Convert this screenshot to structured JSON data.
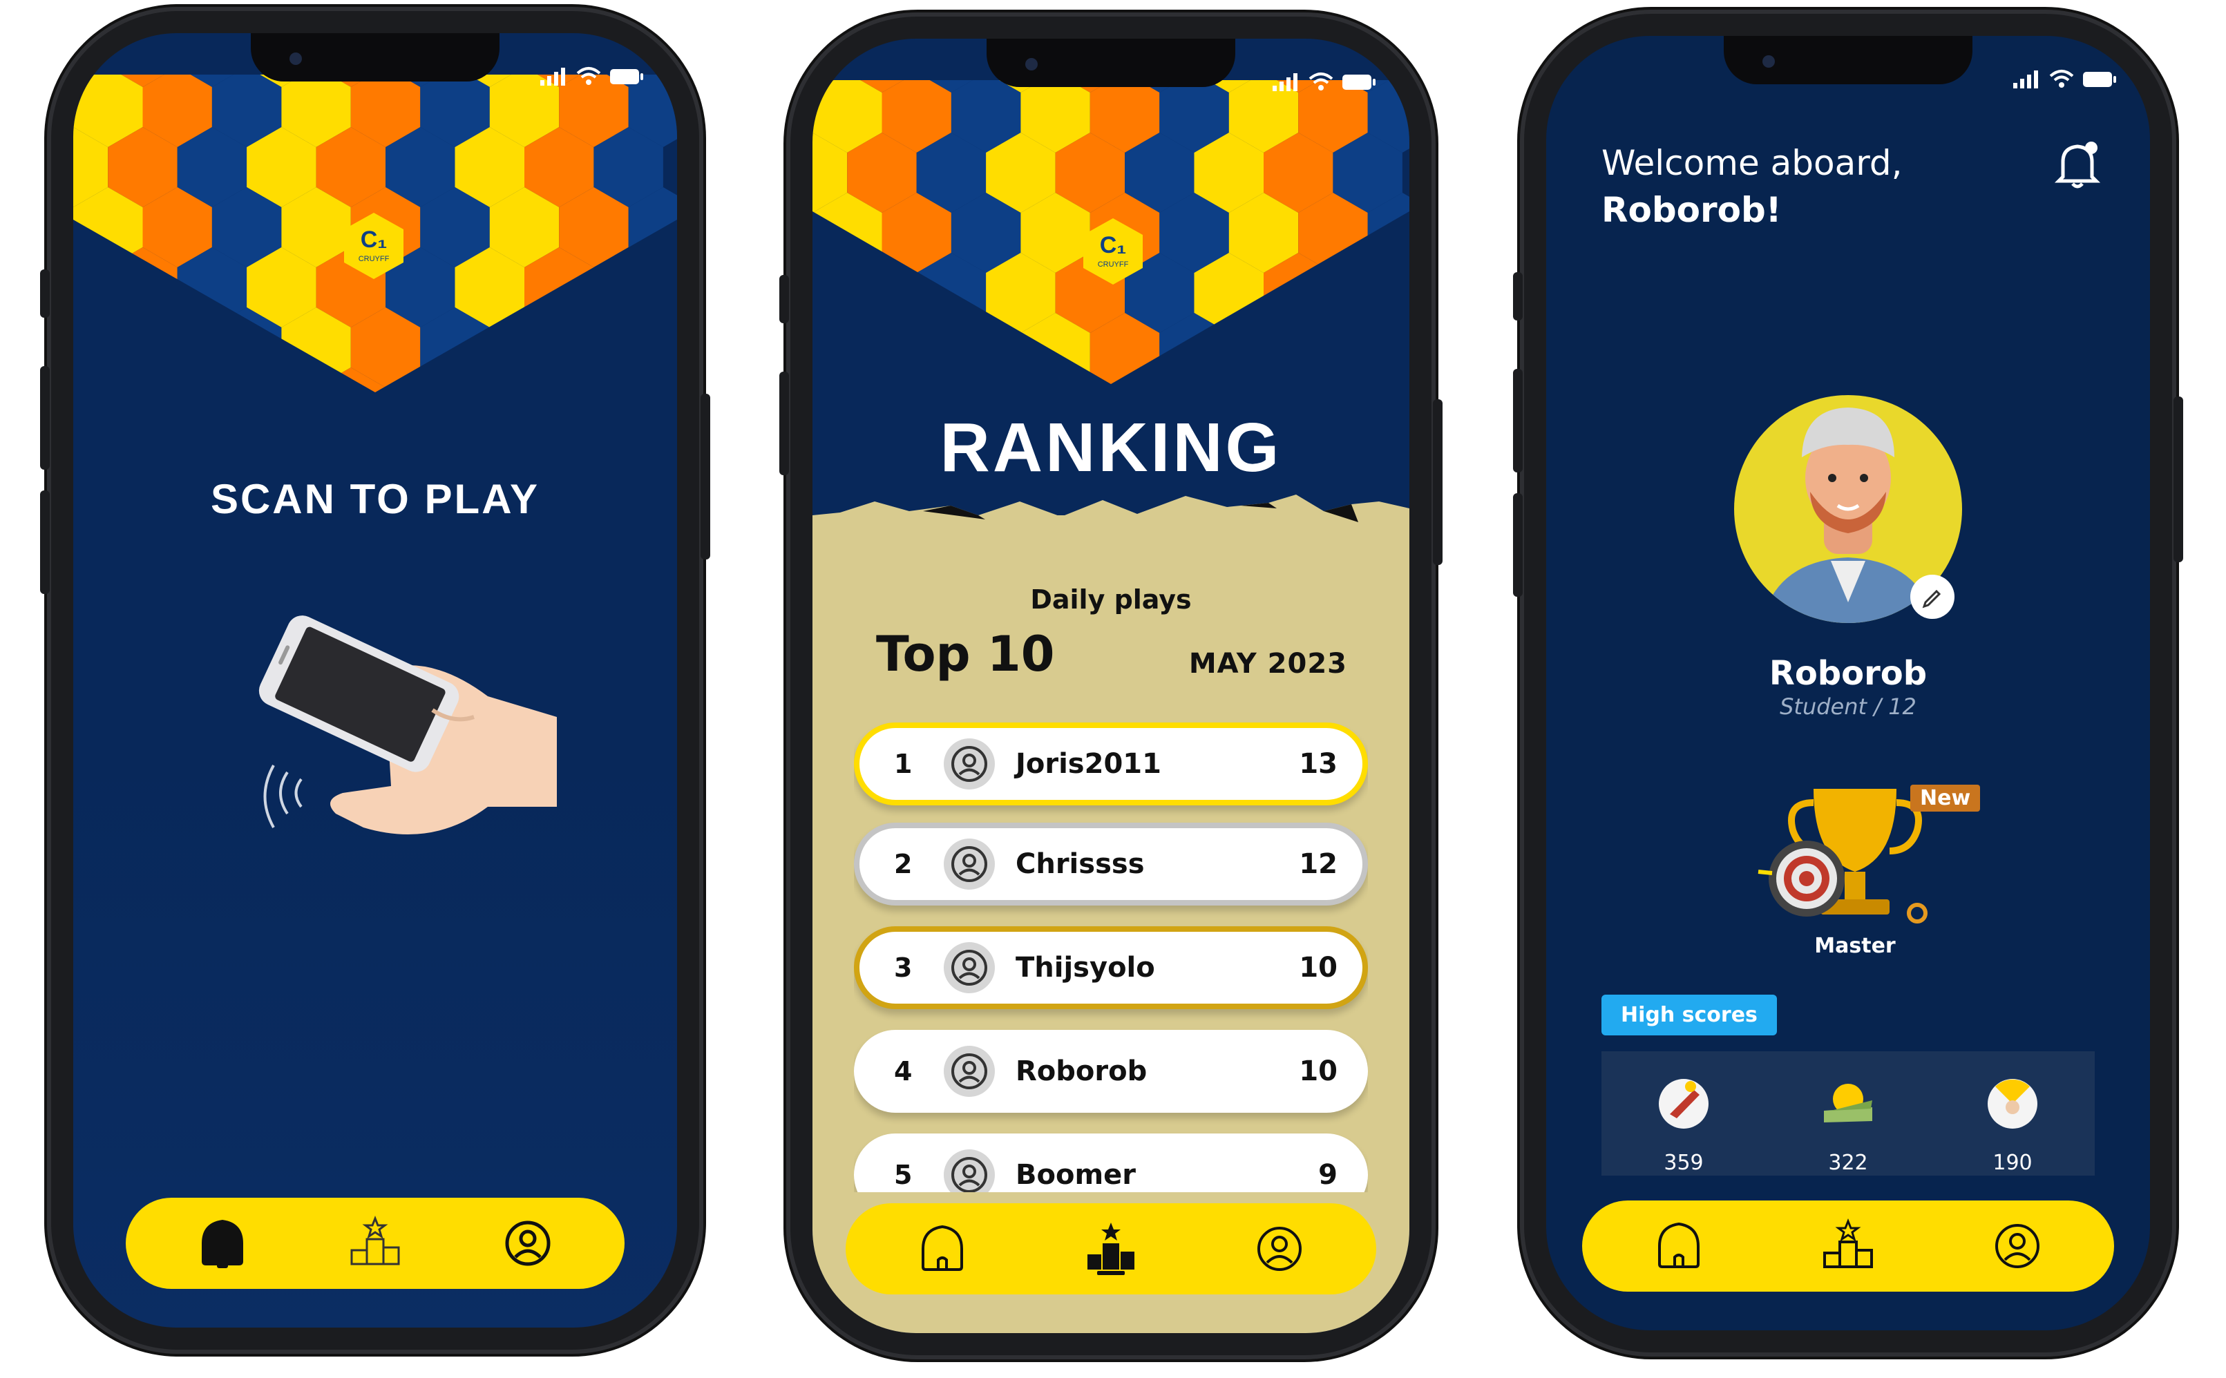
{
  "phone1": {
    "title": "SCAN TO PLAY"
  },
  "phone2": {
    "title": "RANKING",
    "subtitle": "Daily plays",
    "heading": "Top 10",
    "period": "MAY 2023",
    "rows": [
      {
        "pos": "1",
        "name": "Joris2011",
        "score": "13",
        "border": "#ffdd00"
      },
      {
        "pos": "2",
        "name": "Chrissss",
        "score": "12",
        "border": "#c4c4c4"
      },
      {
        "pos": "3",
        "name": "Thijsyolo",
        "score": "10",
        "border": "#d1a413"
      },
      {
        "pos": "4",
        "name": "Roborob",
        "score": "10",
        "border": "#ffffff"
      },
      {
        "pos": "5",
        "name": "Boomer",
        "score": "9",
        "border": "#ffffff"
      }
    ]
  },
  "phone3": {
    "greeting": "Welcome aboard,",
    "username_greeting": "Roborob!",
    "profile_name": "Roborob",
    "profile_sub": "Student / 12",
    "badge_new": "New",
    "achievement": "Master",
    "high_scores_tab": "High scores",
    "scores": [
      "359",
      "322",
      "190"
    ]
  },
  "logo_text": "CRUYFF",
  "nav": {
    "items": [
      "home-icon",
      "podium-icon",
      "profile-icon"
    ]
  },
  "colors": {
    "navy": "#08285a",
    "yellow": "#ffdd00",
    "orange": "#ff7a00",
    "blue_hex": "#0d3f86",
    "sand": "#d8cb8f",
    "accent_blue": "#22aaf0"
  }
}
